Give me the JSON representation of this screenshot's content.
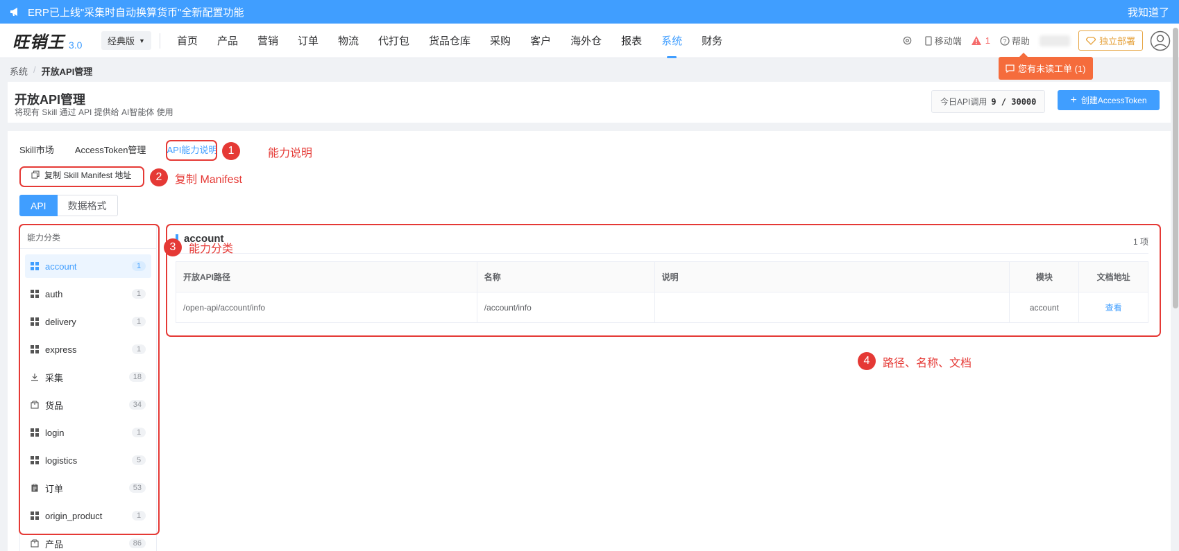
{
  "notice": {
    "text": "ERP已上线\"采集时自动换算货币\"全新配置功能",
    "ack": "我知道了"
  },
  "header": {
    "brand": "旺销王",
    "version": "3.0",
    "edition": "经典版",
    "nav": [
      "首页",
      "产品",
      "营销",
      "订单",
      "物流",
      "代打包",
      "货品仓库",
      "采购",
      "客户",
      "海外仓",
      "报表",
      "系统",
      "财务"
    ],
    "active_nav": "系统",
    "mobile": "移动端",
    "warning_count": "1",
    "help": "帮助",
    "deploy": "独立部署"
  },
  "ticket_tip": "您有未读工单 (1)",
  "breadcrumb": {
    "parent": "系统",
    "current": "开放API管理"
  },
  "page": {
    "title": "开放API管理",
    "subtitle": "将现有 Skill 通过 API 提供给 AI智能体 使用",
    "api_count_label": "今日API调用",
    "api_count_value": "9 / 30000",
    "create_label": "创建AccessToken"
  },
  "tabs": [
    "Skill市场",
    "AccessToken管理",
    "API能力说明"
  ],
  "active_tab": "API能力说明",
  "copy_button": "复制 Skill Manifest 地址",
  "segments": [
    "API",
    "数据格式"
  ],
  "category": {
    "title": "能力分类",
    "items": [
      {
        "label": "account",
        "count": "1",
        "icon": "grid-icon"
      },
      {
        "label": "auth",
        "count": "1",
        "icon": "grid-icon"
      },
      {
        "label": "delivery",
        "count": "1",
        "icon": "grid-icon"
      },
      {
        "label": "express",
        "count": "1",
        "icon": "grid-icon"
      },
      {
        "label": "采集",
        "count": "18",
        "icon": "download-icon"
      },
      {
        "label": "货品",
        "count": "34",
        "icon": "package-icon"
      },
      {
        "label": "login",
        "count": "1",
        "icon": "grid-icon"
      },
      {
        "label": "logistics",
        "count": "5",
        "icon": "grid-icon"
      },
      {
        "label": "订单",
        "count": "53",
        "icon": "clipboard-icon"
      },
      {
        "label": "origin_product",
        "count": "1",
        "icon": "grid-icon"
      },
      {
        "label": "产品",
        "count": "86",
        "icon": "package-icon"
      }
    ]
  },
  "api": {
    "section": "account",
    "count": "1 项",
    "columns": [
      "开放API路径",
      "名称",
      "说明",
      "模块",
      "文档地址"
    ],
    "rows": [
      {
        "path": "/open-api/account/info",
        "name": "/account/info",
        "desc": "",
        "module": "account",
        "doc": "查看"
      }
    ]
  },
  "annotations": {
    "n1": "1",
    "t1": "能力说明",
    "n2": "2",
    "t2": "复制 Manifest",
    "n3": "3",
    "t3": "能力分类",
    "n4": "4",
    "t4": "路径、名称、文档"
  },
  "colors": {
    "primary": "#409eff",
    "annotation": "#e53935",
    "tip": "#f56c3c",
    "deploy": "#e6a23c"
  }
}
